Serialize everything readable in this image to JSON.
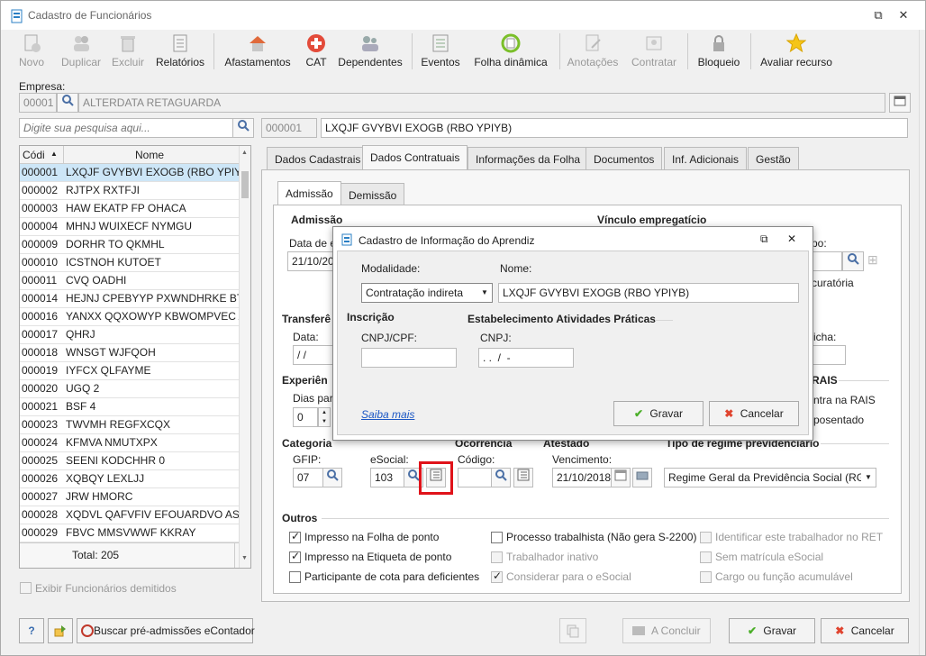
{
  "window": {
    "title": "Cadastro de Funcionários",
    "restore_glyph": "⧉",
    "close_glyph": "✕"
  },
  "toolbar": {
    "novo": "Novo",
    "duplicar": "Duplicar",
    "excluir": "Excluir",
    "relatorios": "Relatórios",
    "afastamentos": "Afastamentos",
    "cat": "CAT",
    "dependentes": "Dependentes",
    "eventos": "Eventos",
    "folha_dinamica": "Folha dinâmica",
    "anotacoes": "Anotações",
    "contratar": "Contratar",
    "bloqueio": "Bloqueio",
    "avaliar": "Avaliar recurso"
  },
  "empresa": {
    "label": "Empresa:",
    "code": "00001",
    "name": "ALTERDATA RETAGUARDA"
  },
  "search": {
    "placeholder": "Digite sua pesquisa aqui..."
  },
  "employee": {
    "code": "000001",
    "name": "LXQJF GVYBVI EXOGB (RBO YPIYB)"
  },
  "list": {
    "col_code": "Códi",
    "col_name": "Nome",
    "sort_glyph": "▲",
    "rows": [
      {
        "code": "000001",
        "name": "LXQJF GVYBVI EXOGB (RBO YPIYB)"
      },
      {
        "code": "000002",
        "name": "RJTPX RXTFJI"
      },
      {
        "code": "000003",
        "name": "HAW EKATP FP OHACA"
      },
      {
        "code": "000004",
        "name": "MHNJ WUIXECF NYMGU"
      },
      {
        "code": "000009",
        "name": "DORHR TO QKMHL"
      },
      {
        "code": "000010",
        "name": "ICSTNOH KUTOET"
      },
      {
        "code": "000011",
        "name": "CVQ OADHI"
      },
      {
        "code": "000014",
        "name": "HEJNJ CPEBYYP PXWNDHRKE BTB J"
      },
      {
        "code": "000016",
        "name": "YANXX QQXOWYP KBWOMPVEC A"
      },
      {
        "code": "000017",
        "name": "QHRJ"
      },
      {
        "code": "000018",
        "name": "WNSGT WJFQOH"
      },
      {
        "code": "000019",
        "name": "IYFCX QLFAYME"
      },
      {
        "code": "000020",
        "name": "UGQ 2"
      },
      {
        "code": "000021",
        "name": "BSF 4"
      },
      {
        "code": "000023",
        "name": "TWVMH REGFXCQX"
      },
      {
        "code": "000024",
        "name": "KFMVA NMUTXPX"
      },
      {
        "code": "000025",
        "name": "SEENI KODCHHR 0"
      },
      {
        "code": "000026",
        "name": "XQBQY LEXLJJ"
      },
      {
        "code": "000027",
        "name": "JRW HMORC"
      },
      {
        "code": "000028",
        "name": "XQDVL QAFVFIV EFOUARDVO AST U"
      },
      {
        "code": "000029",
        "name": "FBVC MMSVWWF KKRAY"
      }
    ],
    "total": "Total: 205"
  },
  "show_dismissed": "Exibir Funcionários demitidos",
  "tabs": [
    "Dados Cadastrais",
    "Dados Contratuais",
    "Informações da Folha",
    "Documentos",
    "Inf. Adicionais",
    "Gestão"
  ],
  "subtabs": [
    "Admissão",
    "Demissão"
  ],
  "form": {
    "admissao": "Admissão",
    "data_e": "Data de e",
    "data_val": "21/10/20",
    "vinculo": "Vínculo empregatício",
    "po": "po:",
    "curatoria": "curatória",
    "transfer": "Transferê",
    "data": "Data:",
    "data_blank": "/ /",
    "ficha": "icha:",
    "experiencia": "Experiên",
    "dias_par": "Dias par",
    "dias_val": "0",
    "rais": "RAIS",
    "ntra_rais": "ntra na RAIS",
    "posentado": "posentado",
    "categoria": "Categoria",
    "ocorrencia": "Ocorrência",
    "atestado": "Atestado",
    "regime_lbl": "Tipo de regime previdenciário",
    "gfip": "GFIP:",
    "gfip_val": "07",
    "esocial": "eSocial:",
    "esocial_val": "103",
    "codigo": "Código:",
    "vencimento": "Vencimento:",
    "vencimento_val": "21/10/2018",
    "regime_val": "Regime Geral da Previdência Social (RGP",
    "outros": "Outros"
  },
  "checks": [
    {
      "label": "Impresso na Folha de ponto",
      "checked": true,
      "enabled": true
    },
    {
      "label": "Impresso na Etiqueta de ponto",
      "checked": true,
      "enabled": true
    },
    {
      "label": "Participante de cota para deficientes",
      "checked": false,
      "enabled": true
    },
    {
      "label": "Processo trabalhista (Não gera S-2200)",
      "checked": false,
      "enabled": true
    },
    {
      "label": "Trabalhador inativo",
      "checked": false,
      "enabled": false
    },
    {
      "label": "Considerar para o eSocial",
      "checked": true,
      "enabled": false
    },
    {
      "label": "Identificar este trabalhador no RET",
      "checked": false,
      "enabled": false
    },
    {
      "label": "Sem matrícula eSocial",
      "checked": false,
      "enabled": false
    },
    {
      "label": "Cargo ou função acumulável",
      "checked": false,
      "enabled": false
    }
  ],
  "bottom": {
    "help": "?",
    "buscar": "Buscar pré-admissões eContador",
    "concluir": "A Concluir",
    "gravar": "Gravar",
    "cancelar": "Cancelar"
  },
  "dialog": {
    "title": "Cadastro de Informação do Aprendiz",
    "modalidade_lbl": "Modalidade:",
    "modalidade_val": "Contratação indireta",
    "nome_lbl": "Nome:",
    "nome_val": "LXQJF GVYBVI EXOGB (RBO YPIYB)",
    "inscricao": "Inscrição",
    "estabelecimento": "Estabelecimento Atividades Práticas",
    "cpf_lbl": "CNPJ/CPF:",
    "cnpj_lbl": "CNPJ:",
    "cnpj_val": ". .  /  -",
    "saiba": "Saiba mais",
    "gravar": "Gravar",
    "cancelar": "Cancelar"
  }
}
